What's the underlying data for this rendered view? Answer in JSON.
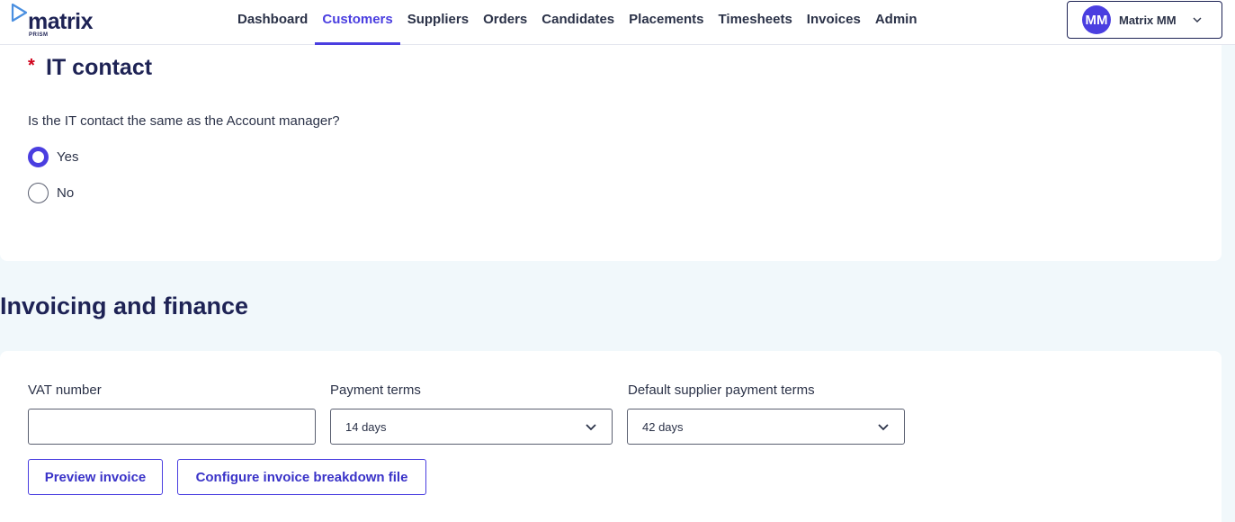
{
  "brand": {
    "logo_text": "matrix",
    "logo_subtext": "PRISM",
    "accent": "#4a3ee0",
    "navy": "#1e2355"
  },
  "nav": {
    "items": [
      {
        "label": "Dashboard",
        "active": false
      },
      {
        "label": "Customers",
        "active": true
      },
      {
        "label": "Suppliers",
        "active": false
      },
      {
        "label": "Orders",
        "active": false
      },
      {
        "label": "Candidates",
        "active": false
      },
      {
        "label": "Placements",
        "active": false
      },
      {
        "label": "Timesheets",
        "active": false
      },
      {
        "label": "Invoices",
        "active": false
      },
      {
        "label": "Admin",
        "active": false
      }
    ]
  },
  "user": {
    "initials": "MM",
    "name": "Matrix MM",
    "chevron_icon": "chevron-down-icon"
  },
  "it_contact": {
    "required_marker": "*",
    "title": "IT contact",
    "question": "Is the IT contact the same as the Account manager?",
    "options": [
      {
        "label": "Yes",
        "checked": true
      },
      {
        "label": "No",
        "checked": false
      }
    ]
  },
  "invoicing": {
    "section_title": "Invoicing and finance",
    "vat": {
      "label": "VAT number",
      "value": "",
      "placeholder": ""
    },
    "payment_terms": {
      "label": "Payment terms",
      "value": "14 days"
    },
    "supplier_terms": {
      "label": "Default supplier payment terms",
      "value": "42 days"
    },
    "buttons": {
      "preview": "Preview invoice",
      "configure": "Configure invoice breakdown file"
    }
  }
}
